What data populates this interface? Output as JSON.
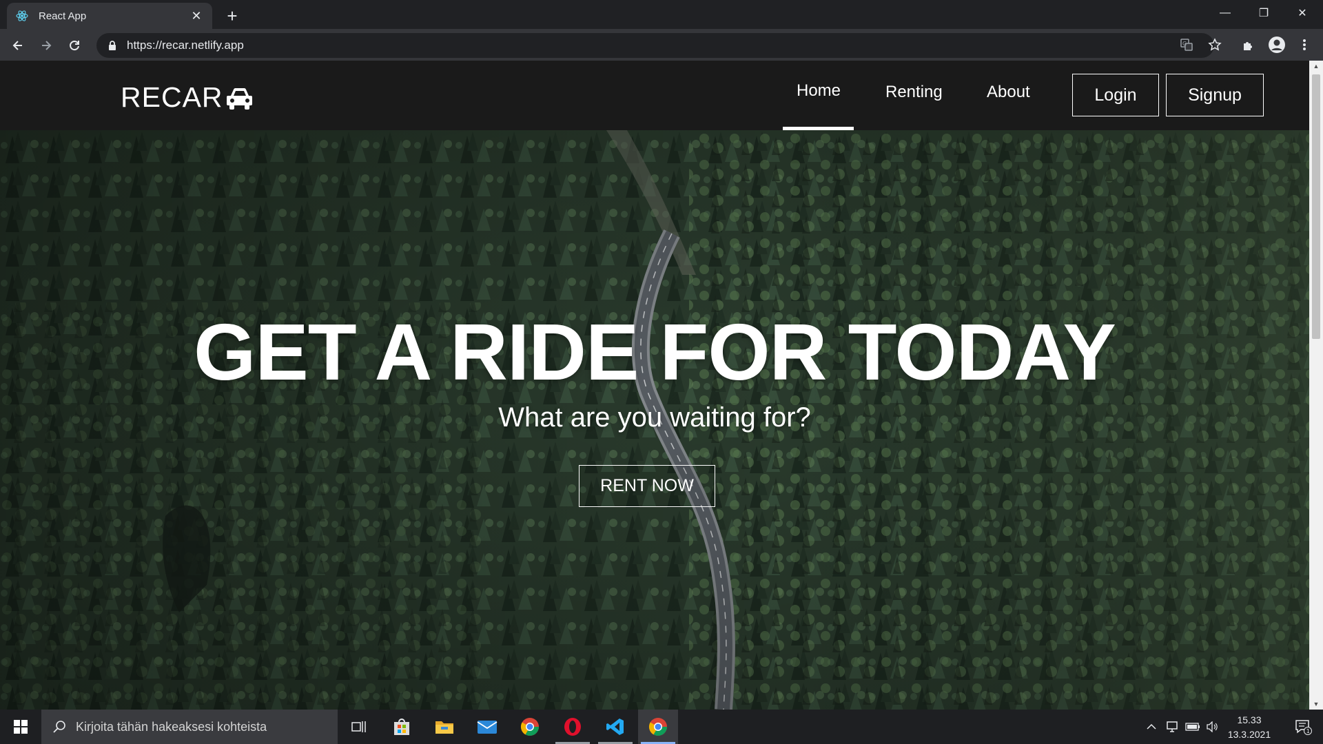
{
  "browser": {
    "tab_title": "React App",
    "url": "https://recar.netlify.app",
    "tab_close_glyph": "✕",
    "new_tab_glyph": "+",
    "window_controls": {
      "minimize": "—",
      "maximize": "❐",
      "close": "✕"
    }
  },
  "site": {
    "logo_text": "RECAR",
    "nav": {
      "home": "Home",
      "renting": "Renting",
      "about": "About",
      "login": "Login",
      "signup": "Signup",
      "active": "Home"
    },
    "hero": {
      "title": "GET A RIDE FOR TODAY",
      "subtitle": "What are you waiting for?",
      "cta": "RENT NOW"
    }
  },
  "taskbar": {
    "search_placeholder": "Kirjoita tähän hakeaksesi kohteista",
    "time": "15.33",
    "date": "13.3.2021",
    "notification_count": "1"
  },
  "colors": {
    "nav_bg": "#1a1a1a",
    "chrome_dark": "#202124",
    "chrome_toolbar": "#35363a",
    "taskbar_bg": "#1e1f22"
  }
}
